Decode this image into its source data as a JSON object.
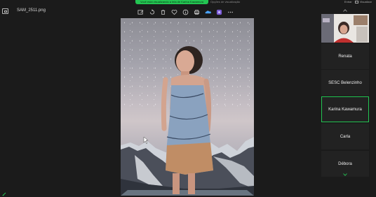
{
  "banner": {
    "text": "Você está visualizando a tela de Karina Kawamura"
  },
  "view_options": {
    "label": "Opções de visualização"
  },
  "top_right": {
    "enter_label": "Entrar",
    "view_label": "Visualizar"
  },
  "viewer": {
    "file_name": "SAM_2511.png"
  },
  "toolbar": {
    "icons": [
      "edit-image-icon",
      "rotate-icon",
      "delete-icon",
      "favorite-icon",
      "info-icon",
      "print-icon",
      "onedrive-icon",
      "clipchamp-icon",
      "more-icon"
    ]
  },
  "participants": [
    {
      "name": "Renata",
      "active": false
    },
    {
      "name": "SESC Belenzinho",
      "active": false
    },
    {
      "name": "Karina Kawamura",
      "active": true
    },
    {
      "name": "Carla",
      "active": false
    },
    {
      "name": "Débora",
      "active": false
    }
  ],
  "colors": {
    "accent_green": "#23c552",
    "background": "#1b1b1b",
    "tile": "#222222"
  }
}
